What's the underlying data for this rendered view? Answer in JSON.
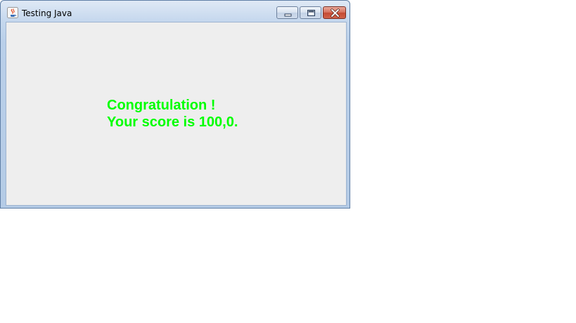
{
  "window": {
    "title": "Testing Java",
    "icon": "java-coffee-icon",
    "controls": {
      "minimize_icon": "minimize-icon",
      "maximize_icon": "maximize-icon",
      "close_icon": "close-icon"
    }
  },
  "content": {
    "line1": "Congratulation !",
    "line2": "Your score is 100,0.",
    "text_color": "#00ff00",
    "background_color": "#eeeeee"
  }
}
